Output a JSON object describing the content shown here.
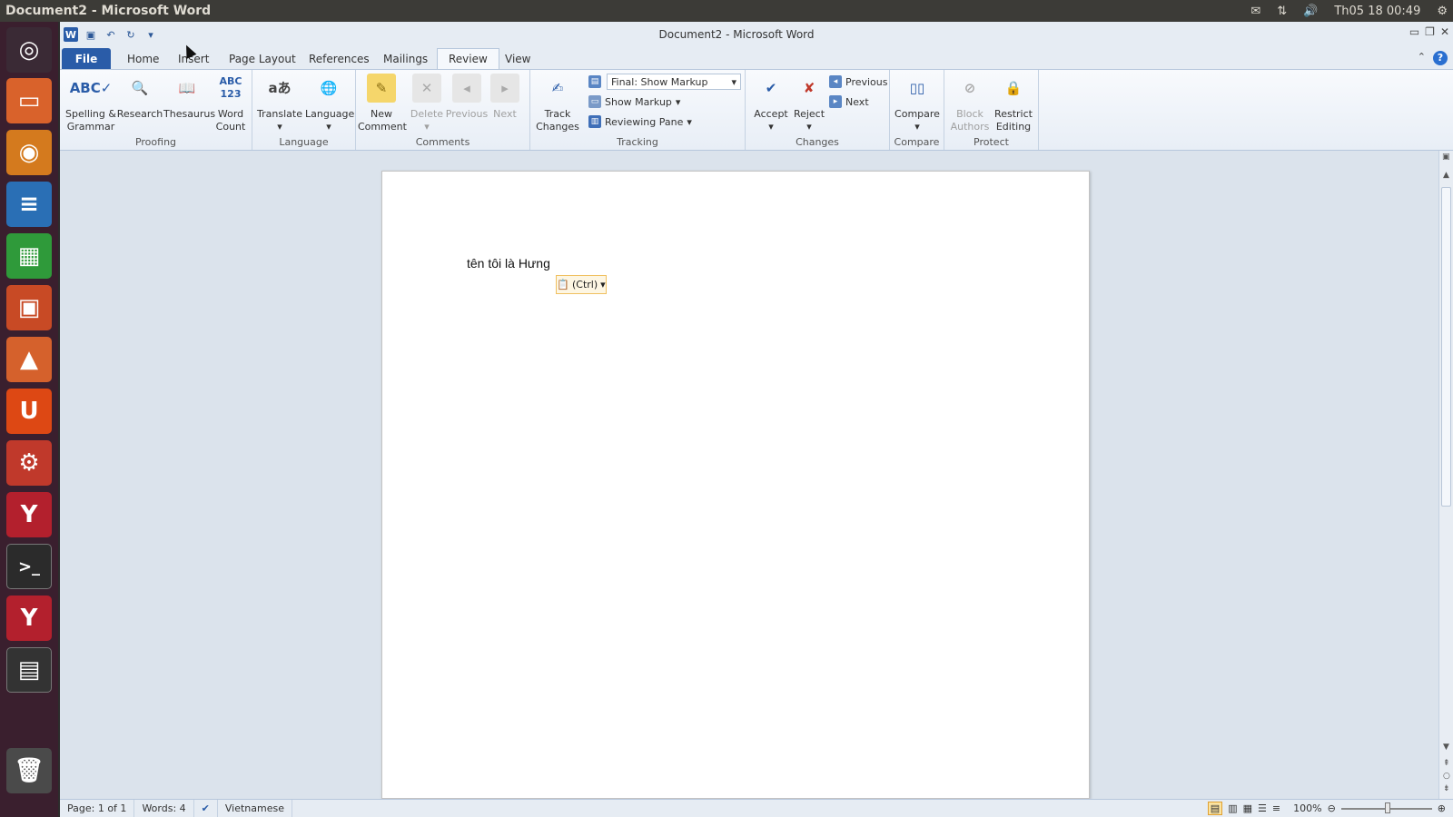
{
  "panel": {
    "title": "Document2 - Microsoft Word",
    "clock": "Th05 18 00:49"
  },
  "launcher": {
    "items": [
      "ubuntu-dash",
      "files",
      "firefox",
      "libreoffice-writer",
      "libreoffice-calc",
      "libreoffice-impress",
      "software-center",
      "ubuntu-one",
      "system-settings",
      "wine",
      "terminal",
      "wine",
      "workspace-switcher",
      "trash"
    ]
  },
  "window": {
    "title": "Document2 - Microsoft Word"
  },
  "tabs": {
    "file": "File",
    "home": "Home",
    "insert": "Insert",
    "page_layout": "Page Layout",
    "references": "References",
    "mailings": "Mailings",
    "review": "Review",
    "view": "View"
  },
  "ribbon": {
    "proofing": {
      "label": "Proofing",
      "spelling": "Spelling &\nGrammar",
      "research": "Research",
      "thesaurus": "Thesaurus",
      "word_count": "Word\nCount"
    },
    "language": {
      "label": "Language",
      "translate": "Translate",
      "language": "Language"
    },
    "comments": {
      "label": "Comments",
      "new_comment": "New\nComment",
      "delete": "Delete",
      "previous": "Previous",
      "next": "Next"
    },
    "tracking": {
      "label": "Tracking",
      "track_changes": "Track\nChanges",
      "display_mode": "Final: Show Markup",
      "show_markup": "Show Markup",
      "reviewing_pane": "Reviewing Pane"
    },
    "changes": {
      "label": "Changes",
      "accept": "Accept",
      "reject": "Reject",
      "previous": "Previous",
      "next": "Next"
    },
    "compare": {
      "label": "Compare",
      "compare": "Compare"
    },
    "protect": {
      "label": "Protect",
      "block_authors": "Block\nAuthors",
      "restrict_editing": "Restrict\nEditing"
    }
  },
  "document": {
    "text": "tên tôi là Hưng",
    "paste_options": "(Ctrl)"
  },
  "status": {
    "page": "Page: 1 of 1",
    "words": "Words: 4",
    "language": "Vietnamese",
    "zoom": "100%"
  },
  "colors": {
    "accent": "#2a5ca8",
    "launcher_bg": "#3a1f2e",
    "panel_bg": "#3c3b37"
  }
}
